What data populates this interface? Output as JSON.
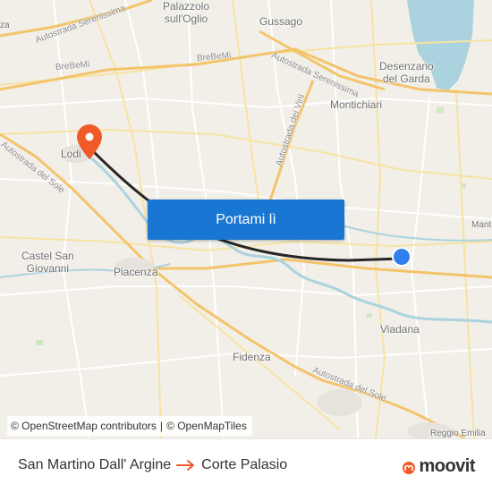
{
  "map": {
    "places": [
      {
        "id": "palazzolo",
        "name": "Palazzolo\nsull'Oglio"
      },
      {
        "id": "gussago",
        "name": "Gussago"
      },
      {
        "id": "desenzano",
        "name": "Desenzano\ndel Garda"
      },
      {
        "id": "montichiari",
        "name": "Montichiari"
      },
      {
        "id": "lodi",
        "name": "Lodi"
      },
      {
        "id": "castel-san-giovanni",
        "name": "Castel San\nGiovanni"
      },
      {
        "id": "piacenza",
        "name": "Piacenza"
      },
      {
        "id": "viadana",
        "name": "Viadana"
      },
      {
        "id": "fidenza",
        "name": "Fidenza"
      },
      {
        "id": "reggio-emilia",
        "name": "Reggio Emilia"
      },
      {
        "id": "mantova-partial",
        "name": "Mant"
      },
      {
        "id": "top-left-partial",
        "name": "za"
      }
    ],
    "roads": [
      {
        "id": "autostrada-serenissima-nw",
        "name": "Autostrada Serenissima"
      },
      {
        "id": "brebemi-1",
        "name": "BreBeMi"
      },
      {
        "id": "brebemi-2",
        "name": "BreBeMi"
      },
      {
        "id": "autostrada-serenissima-e",
        "name": "Autostrada Serenissima"
      },
      {
        "id": "autostrada-dei-vini",
        "name": "Autostrada dei Vini"
      },
      {
        "id": "autostrada-del-sole-w",
        "name": "Autostrada del Sole"
      },
      {
        "id": "autostrada-del-sole-e",
        "name": "Autostrada del Sole"
      }
    ],
    "origin_marker": {
      "label": "San Martino Dall' Argine",
      "color": "#2f80ed"
    },
    "destination_marker": {
      "label": "Corte Palasio",
      "color": "#f05a28"
    },
    "route_color": "#262626",
    "water_color": "#aad3df"
  },
  "cta": {
    "label": "Portami lì"
  },
  "attribution": {
    "osm": "© OpenStreetMap contributors",
    "separator": "|",
    "omt": "© OpenMapTiles"
  },
  "footer": {
    "from": "San Martino Dall' Argine",
    "to": "Corte Palasio",
    "brand": "moovit",
    "brand_color": "#f05a28"
  }
}
